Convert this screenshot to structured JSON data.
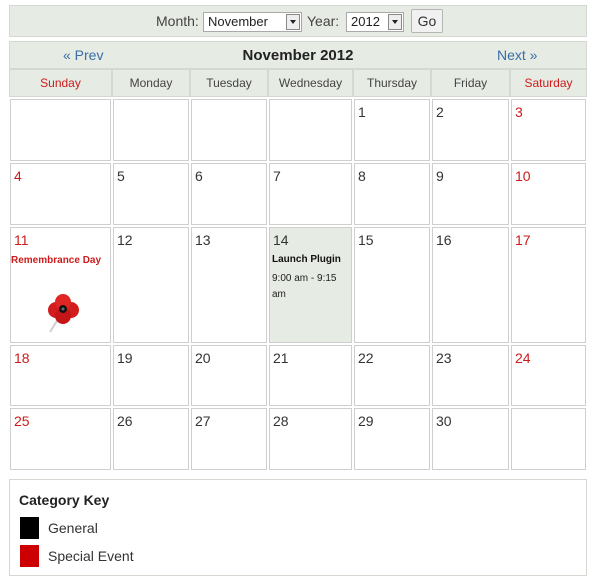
{
  "controls": {
    "month_label": "Month:",
    "month_value": "November",
    "year_label": "Year:",
    "year_value": "2012",
    "go_label": "Go"
  },
  "nav": {
    "prev_label": "« Prev",
    "title": "November 2012",
    "next_label": "Next »"
  },
  "weekdays": [
    "Sunday",
    "Monday",
    "Tuesday",
    "Wednesday",
    "Thursday",
    "Friday",
    "Saturday"
  ],
  "weeks": [
    [
      "",
      "",
      "",
      "",
      "1",
      "2",
      "3"
    ],
    [
      "4",
      "5",
      "6",
      "7",
      "8",
      "9",
      "10"
    ],
    [
      "11",
      "12",
      "13",
      "14",
      "15",
      "16",
      "17"
    ],
    [
      "18",
      "19",
      "20",
      "21",
      "22",
      "23",
      "24"
    ],
    [
      "25",
      "26",
      "27",
      "28",
      "29",
      "30",
      ""
    ]
  ],
  "events": {
    "holiday": {
      "name": "Remembrance Day",
      "icon": "poppy-icon"
    },
    "launch": {
      "title": "Launch Plugin",
      "time": "9:00 am - 9:15 am"
    }
  },
  "category_key": {
    "title": "Category Key",
    "items": [
      {
        "label": "General",
        "color": "#000000"
      },
      {
        "label": "Special Event",
        "color": "#cc0000"
      }
    ]
  }
}
